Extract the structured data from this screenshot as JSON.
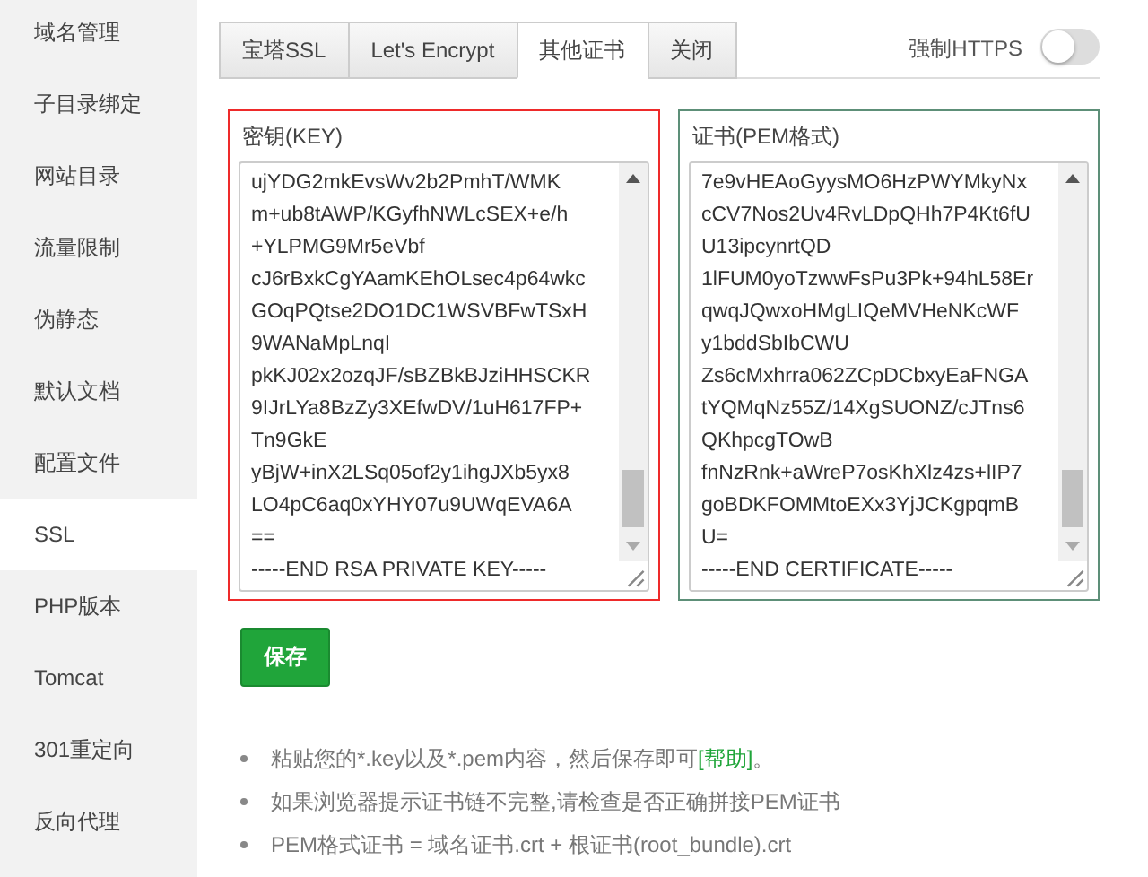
{
  "sidebar": {
    "items": [
      {
        "label": "域名管理",
        "selected": false
      },
      {
        "label": "子目录绑定",
        "selected": false
      },
      {
        "label": "网站目录",
        "selected": false
      },
      {
        "label": "流量限制",
        "selected": false
      },
      {
        "label": "伪静态",
        "selected": false
      },
      {
        "label": "默认文档",
        "selected": false
      },
      {
        "label": "配置文件",
        "selected": false
      },
      {
        "label": "SSL",
        "selected": true
      },
      {
        "label": "PHP版本",
        "selected": false
      },
      {
        "label": "Tomcat",
        "selected": false
      },
      {
        "label": "301重定向",
        "selected": false
      },
      {
        "label": "反向代理",
        "selected": false
      }
    ]
  },
  "tabs": [
    {
      "label": "宝塔SSL",
      "selected": false
    },
    {
      "label": "Let's Encrypt",
      "selected": false
    },
    {
      "label": "其他证书",
      "selected": true
    },
    {
      "label": "关闭",
      "selected": false
    }
  ],
  "force_https": {
    "label": "强制HTTPS",
    "on": false
  },
  "key": {
    "label": "密钥(KEY)",
    "lines": [
      "ujYDG2mkEvsWv2b2PmhT/WMK",
      "m+ub8tAWP/KGyfhNWLcSEX+e/h",
      "+YLPMG9Mr5eVbf",
      "cJ6rBxkCgYAamKEhOLsec4p64wkc",
      "GOqPQtse2DO1DC1WSVBFwTSxH",
      "9WANaMpLnqI",
      "pkKJ02x2ozqJF/sBZBkBJziHHSCKR",
      "9IJrLYa8BzZy3XEfwDV/1uH617FP+",
      "Tn9GkE",
      "yBjW+inX2LSq05of2y1ihgJXb5yx8",
      "LO4pC6aq0xYHY07u9UWqEVA6A",
      "==",
      "-----END RSA PRIVATE KEY-----"
    ]
  },
  "certificate": {
    "label": "证书(PEM格式)",
    "lines": [
      "7e9vHEAoGyysMO6HzPWYMkyNx",
      "cCV7Nos2Uv4RvLDpQHh7P4Kt6fU",
      "U13ipcynrtQD",
      "1lFUM0yoTzwwFsPu3Pk+94hL58Er",
      "qwqJQwxoHMgLIQeMVHeNKcWF",
      "y1bddSbIbCWU",
      "Zs6cMxhrra062ZCpDCbxyEaFNGA",
      "tYQMqNz55Z/14XgSUONZ/cJTns6",
      "QKhpcgTOwB",
      "fnNzRnk+aWreP7osKhXlz4zs+lIP7",
      "goBDKFOMMtoEXx3YjJCKgpqmB",
      "U=",
      "-----END CERTIFICATE-----"
    ]
  },
  "save_button": "保存",
  "notes": [
    {
      "text": "粘贴您的*.key以及*.pem内容，然后保存即可",
      "link": "[帮助]",
      "tail": "。"
    },
    {
      "text": "如果浏览器提示证书链不完整,请检查是否正确拼接PEM证书"
    },
    {
      "text": "PEM格式证书 = 域名证书.crt + 根证书(root_bundle).crt"
    }
  ]
}
